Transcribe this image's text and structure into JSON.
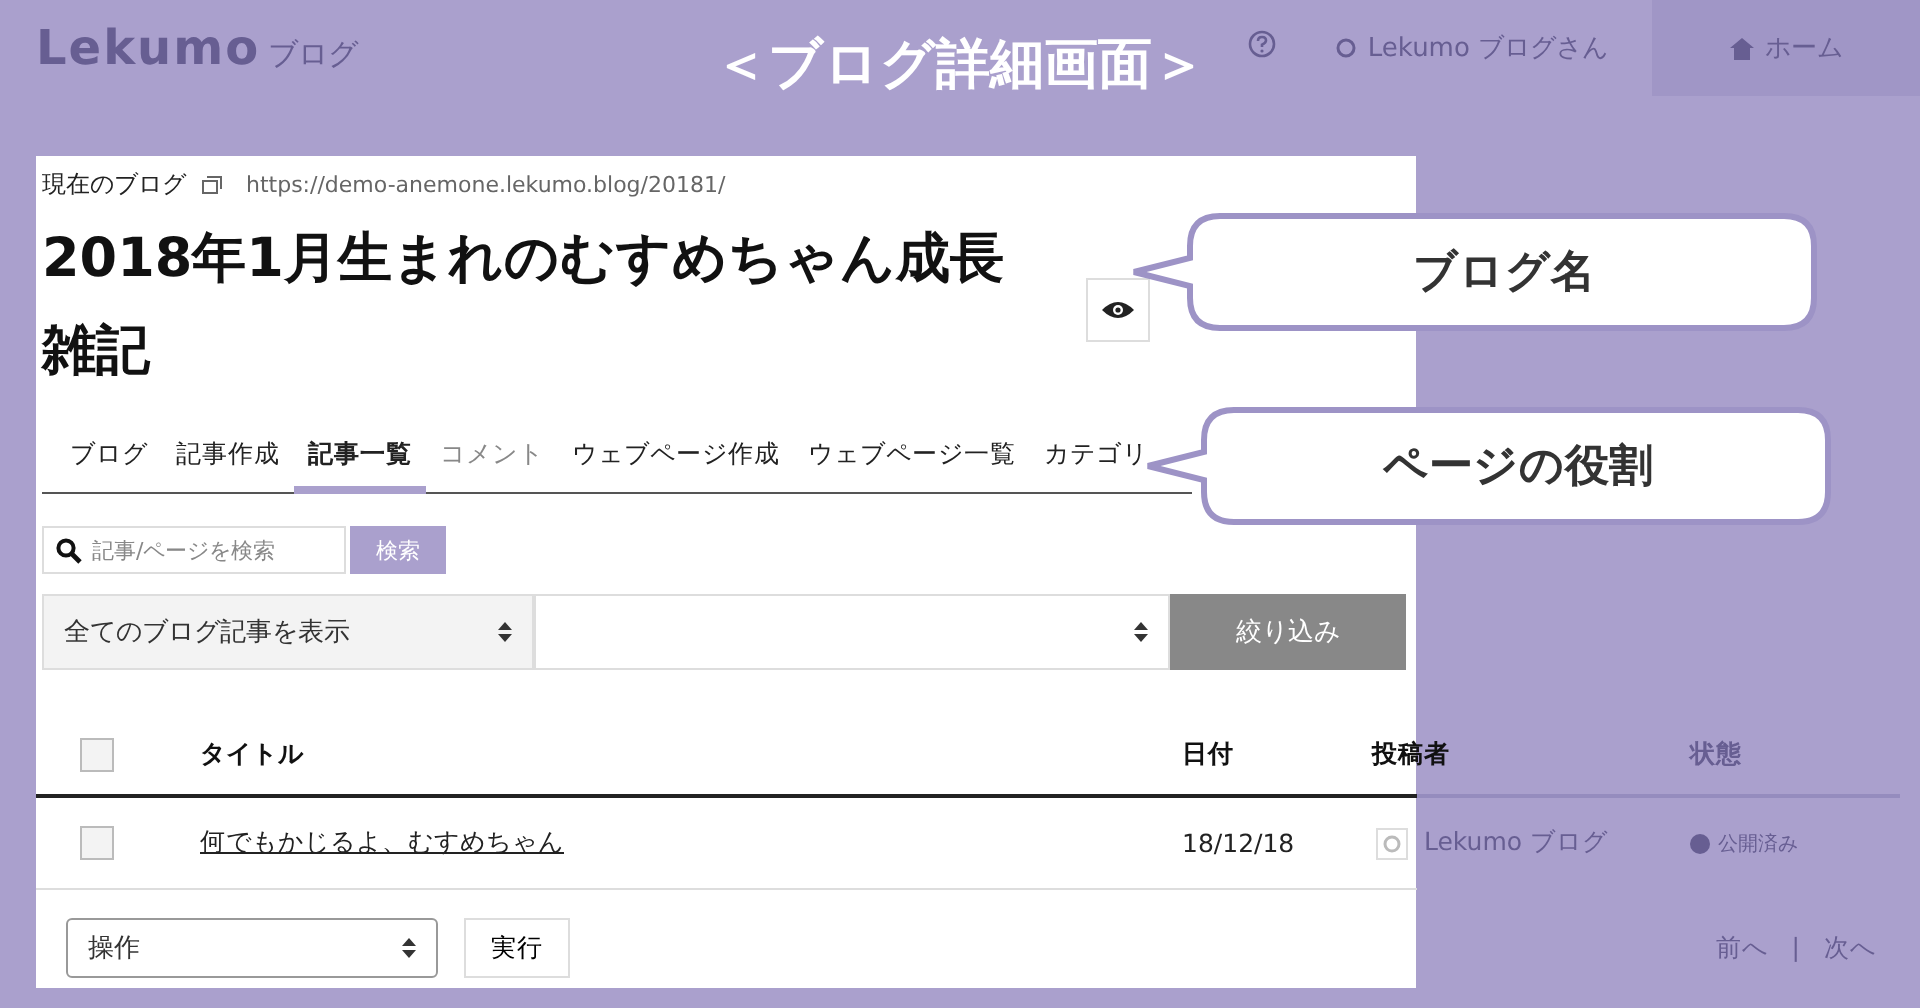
{
  "page_title": "＜ブログ詳細画面＞",
  "header": {
    "logo": "Lekumo",
    "logo_suffix": "ブログ",
    "user_button": "Lekumo ブログさん",
    "home_button": "ホーム"
  },
  "blog": {
    "label": "現在のブログ",
    "url": "https://demo-anemone.lekumo.blog/20181/",
    "name": "2018年1月生まれのむすめちゃん成長雑記"
  },
  "tabs": [
    {
      "label": "ブログ",
      "selected": false,
      "disabled": false
    },
    {
      "label": "記事作成",
      "selected": false,
      "disabled": false
    },
    {
      "label": "記事一覧",
      "selected": true,
      "disabled": false
    },
    {
      "label": "コメント",
      "selected": false,
      "disabled": true
    },
    {
      "label": "ウェブページ作成",
      "selected": false,
      "disabled": false
    },
    {
      "label": "ウェブページ一覧",
      "selected": false,
      "disabled": false
    },
    {
      "label": "カテゴリ",
      "selected": false,
      "disabled": false
    }
  ],
  "search": {
    "placeholder": "記事/ページを検索",
    "button": "検索"
  },
  "filters": {
    "type_select": "全てのブログ記事を表示",
    "button": "絞り込み"
  },
  "table": {
    "header_checked": false,
    "columns": [
      "タイトル",
      "日付",
      "投稿者",
      "状態"
    ],
    "rows": [
      {
        "checked": false,
        "title": "何でもかじるよ、むすめちゃん",
        "date": "18/12/18",
        "author": "Lekumo ブログ",
        "status": "公開済み"
      }
    ]
  },
  "actions": {
    "select": "操作",
    "button": "実行"
  },
  "pagination": {
    "prev": "前へ",
    "separator": "|",
    "next": "次へ"
  },
  "callouts": [
    {
      "text": "ブログ名"
    },
    {
      "text": "ページの役割"
    }
  ]
}
